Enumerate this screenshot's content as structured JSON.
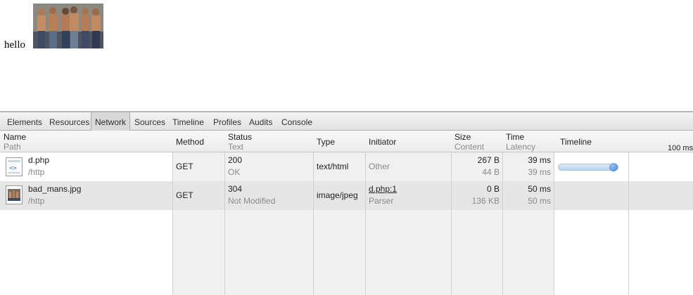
{
  "page": {
    "text": "hello",
    "image_alt": "bad_mans.jpg"
  },
  "devtools": {
    "tabs": [
      "Elements",
      "Resources",
      "Network",
      "Sources",
      "Timeline",
      "Profiles",
      "Audits",
      "Console"
    ],
    "active_tab": "Network",
    "columns": {
      "name": "Name",
      "path": "Path",
      "method": "Method",
      "status": "Status",
      "text": "Text",
      "type": "Type",
      "initiator": "Initiator",
      "size": "Size",
      "content": "Content",
      "time": "Time",
      "latency": "Latency",
      "timeline": "Timeline",
      "scale": "100 ms"
    },
    "rows": [
      {
        "name": "d.php",
        "path": "/http",
        "method": "GET",
        "status": "200",
        "status_text": "OK",
        "type": "text/html",
        "initiator": "Other",
        "initiator_sub": "",
        "size": "267 B",
        "content": "44 B",
        "time": "39 ms",
        "latency": "39 ms",
        "icon": "html-file-icon",
        "timeline_fill": 1.0
      },
      {
        "name": "bad_mans.jpg",
        "path": "/http",
        "method": "GET",
        "status": "304",
        "status_text": "Not Modified",
        "type": "image/jpeg",
        "initiator": "d.php:1",
        "initiator_sub": "Parser",
        "size": "0 B",
        "content": "136 KB",
        "time": "50 ms",
        "latency": "50 ms",
        "icon": "image-file-icon",
        "timeline_fill": 0
      }
    ]
  }
}
